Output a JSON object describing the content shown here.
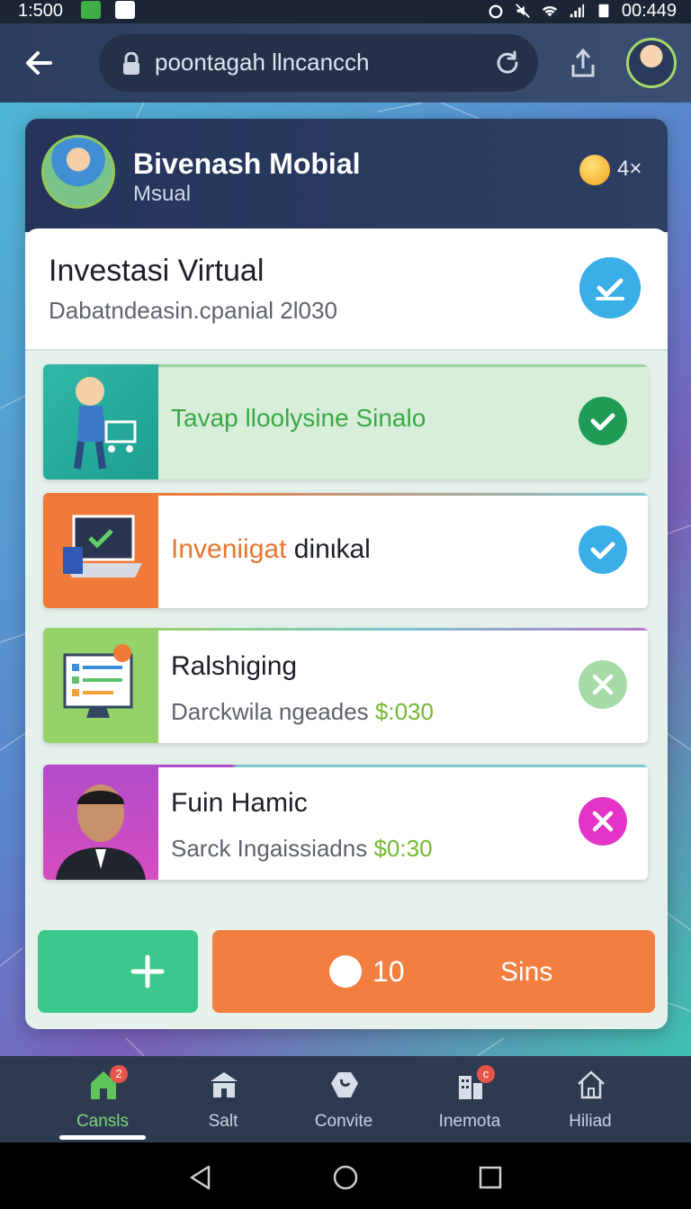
{
  "status_bar": {
    "time": "1:500",
    "clock_right": "00:449"
  },
  "app_bar": {
    "url": "poontagah llncancch"
  },
  "header": {
    "title": "Bivenash Mobial",
    "subtitle": "Msual",
    "coins": "4×"
  },
  "summary": {
    "title": "Investasi Virtual",
    "subtitle": "Dabatndeasin.cpanial 2l030"
  },
  "items": [
    {
      "title": "Tavap lloolysine Sinalo",
      "status": "check"
    },
    {
      "title_a": "Inveniigat",
      "title_b": "dinιkal",
      "status": "check"
    },
    {
      "title": "Ralshiging",
      "sub": "Darckwila ngeades",
      "amount": "$:030",
      "status": "cancel"
    },
    {
      "title": "Fuin Hamic",
      "sub": "Sarck Ingaissiadns",
      "amount": "$0:30",
      "status": "cancel"
    }
  ],
  "actions": {
    "spin_count": "10",
    "spin_label": "Sins"
  },
  "bottom_nav": [
    {
      "label": "Cansls",
      "badge": "2",
      "icon": "home-icon"
    },
    {
      "label": "Salt",
      "icon": "store-icon"
    },
    {
      "label": "Convite",
      "icon": "puzzle-icon"
    },
    {
      "label": "Inemota",
      "badge": "c",
      "icon": "building-icon"
    },
    {
      "label": "Hiliad",
      "icon": "house-outline-icon"
    }
  ],
  "colors": {
    "accent_green": "#3cc88c",
    "accent_orange": "#f27e3f",
    "check_blue": "#3aaee7",
    "check_green": "#1e9c55",
    "cancel_light_green": "#a6dba8",
    "cancel_magenta": "#e434c8"
  }
}
